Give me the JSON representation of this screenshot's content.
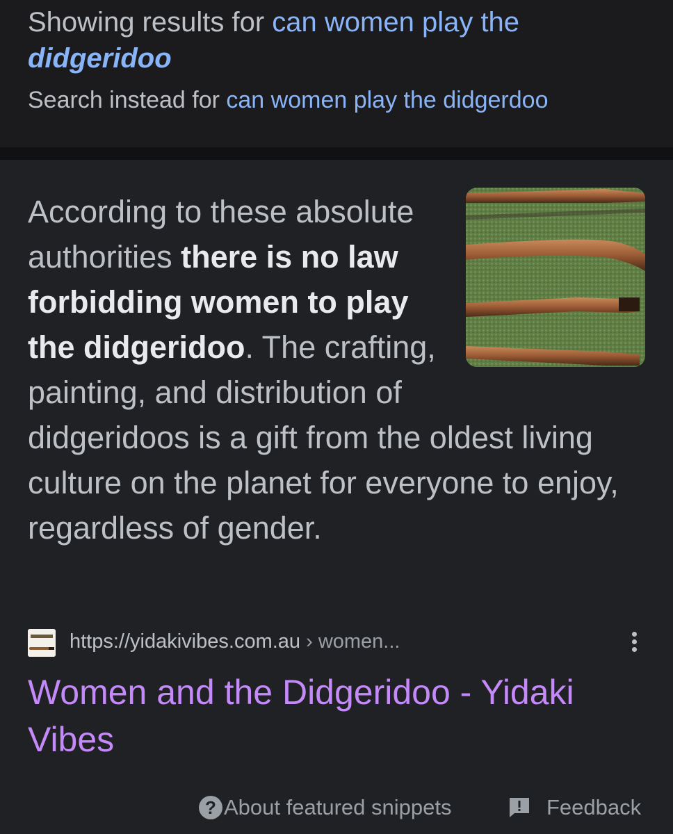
{
  "spelling": {
    "showing_prefix": "Showing results for ",
    "corrected_plain": "can women play the",
    "corrected_emph": "didgeridoo",
    "instead_prefix": "Search instead for ",
    "original_query": "can women play the didgerdoo"
  },
  "snippet": {
    "text_intro": "According to these absolute authorities ",
    "text_bold": "there is no law forbidding women to play the didgeridoo",
    "text_rest": ". The crafting, painting, and distribution of didgeridoos is a gift from the oldest living culture on the planet for everyone to enjoy, regardless of gender.",
    "image_alt": "didgeridoos on grass"
  },
  "source": {
    "url": "https://yidakivibes.com.au",
    "path": " › women...",
    "favicon_text": "Yidaki Vibes"
  },
  "result": {
    "title": "Women and the Didgeridoo - Yidaki Vibes"
  },
  "footer": {
    "about_label": "About featured snippets",
    "feedback_label": "Feedback"
  },
  "colors": {
    "background": "#202124",
    "link_blue": "#8ab4f8",
    "visited_purple": "#c58af9",
    "text_gray": "#bdc1c6"
  }
}
